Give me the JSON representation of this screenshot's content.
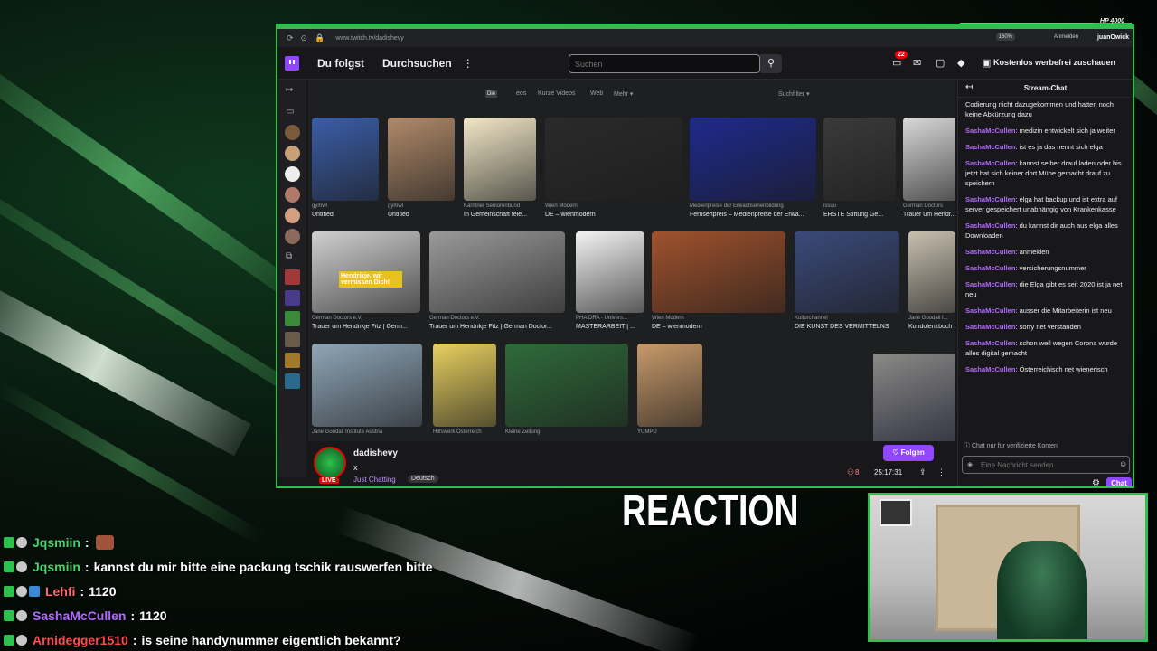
{
  "hud": {
    "hp_label": "HP 4000",
    "hp_fraction": 0.78
  },
  "browser": {
    "url": "www.twitch.tv/dadishevy",
    "zoom": "160%",
    "profile_label": "Anmelden",
    "streamer_name": "juanOwick"
  },
  "twitch_nav": {
    "following": "Du folgst",
    "browse": "Durchsuchen",
    "more": "⋮",
    "search_placeholder": "Suchen",
    "notif_count": "22",
    "ad_free": "Kostenlos werbefrei zuschauen"
  },
  "google_tabs": {
    "tooltip": "Die",
    "items": [
      "eos",
      "Kurze Videos",
      "Web",
      "Mehr ▾"
    ],
    "filter": "Suchfilter ▾"
  },
  "image_results": {
    "row1": [
      {
        "src": "gymwl",
        "title": "Untitled",
        "color": "#3b5ea8"
      },
      {
        "src": "gymwl",
        "title": "Untitled",
        "color": "#b08a6a"
      },
      {
        "src": "Kärntner Seniorenbund",
        "title": "In Gemeinschaft feie...",
        "color": "#f2e8c8"
      },
      {
        "src": "Wien Modern",
        "title": "DE – wienmodern",
        "color": "#2a2a2a"
      },
      {
        "src": "Medienpreise der Erwachsenenbildung",
        "title": "Fernsehpreis – Medienpreise der Erwa...",
        "color": "#1e2a8c"
      },
      {
        "src": "issuu",
        "title": "ERSTE Stiftung Ge...",
        "color": "#3a3a3a"
      },
      {
        "src": "German Doctors",
        "title": "Trauer um Hendr...",
        "color": "#d9d9d9"
      }
    ],
    "row2": [
      {
        "src": "German Doctors e.V.",
        "title": "Trauer um Hendrikje Fitz | Germ...",
        "color": "#d0d0d0",
        "overlay": "Hendrikje, wir vermissen Dich!"
      },
      {
        "src": "German Doctors e.V.",
        "title": "Trauer um Hendrikje Fitz | German Doctor...",
        "color": "#9a9a9a"
      },
      {
        "src": "PHAIDRA - Univers...",
        "title": "MASTERARBEIT | ...",
        "color": "#f4f4f4"
      },
      {
        "src": "Wien Modern",
        "title": "DE – wienmodern",
        "color": "#a0522d"
      },
      {
        "src": "Kulturchannel",
        "title": "DIE KUNST DES VERMITTELNS",
        "color": "#3a4a7a"
      },
      {
        "src": "Jane Goodall I...",
        "title": "Kondolenzbuch ...",
        "color": "#c8c0b0"
      }
    ],
    "row3": [
      {
        "src": "Jane Goodall Institute Austria",
        "title": "",
        "color": "#8fa6b8"
      },
      {
        "src": "Hilfswerk Österreich",
        "title": "",
        "color": "#e8d060"
      },
      {
        "src": "Kleine Zeitung",
        "title": "",
        "color": "#2f6b3a"
      },
      {
        "src": "YUMPU",
        "title": "",
        "color": "#c89a6a"
      }
    ]
  },
  "stream_info": {
    "channel": "dadishevy",
    "title": "x",
    "category": "Just Chatting",
    "tag": "Deutsch",
    "live": "LIVE",
    "follow": "♡ Folgen",
    "viewers": "8",
    "uptime": "25:17:31"
  },
  "chat": {
    "header": "Stream-Chat",
    "messages": [
      {
        "user": "",
        "text": "Codierung nicht dazugekommen und hatten noch keine Abkürzung dazu"
      },
      {
        "user": "SashaMcCullen",
        "text": "medizin entwickelt sich ja weiter"
      },
      {
        "user": "SashaMcCullen",
        "text": "ist es ja das nennt sich elga"
      },
      {
        "user": "SashaMcCullen",
        "text": "kannst selber drauf laden oder bis jetzt hat sich keiner dort Mühe gemacht drauf zu speichern"
      },
      {
        "user": "SashaMcCullen",
        "text": "elga hat backup und ist extra auf server gespeichert unabhängig von Krankenkasse"
      },
      {
        "user": "SashaMcCullen",
        "text": "du kannst dir auch aus elga alles Downloaden"
      },
      {
        "user": "SashaMcCullen",
        "text": "anmelden"
      },
      {
        "user": "SashaMcCullen",
        "text": "versicherungsnummer"
      },
      {
        "user": "SashaMcCullen",
        "text": "die Elga gibt es seit 2020 ist ja net neu"
      },
      {
        "user": "SashaMcCullen",
        "text": "ausser die Mitarbeiterin ist neu"
      },
      {
        "user": "SashaMcCullen",
        "text": "sorry net verstanden"
      },
      {
        "user": "SashaMcCullen",
        "text": "schon weil wegen Corona wurde alles digital gemacht"
      },
      {
        "user": "SashaMcCullen",
        "text": "Österreichisch net wienerisch"
      }
    ],
    "verified_notice": "Chat nur für verifizierte Konten",
    "input_placeholder": "Eine Nachricht senden",
    "send_label": "Chat"
  },
  "overlay": {
    "title": "REACTION",
    "messages": [
      {
        "user": "Jqsmiin",
        "color": "#3fd86a",
        "text": "",
        "emote": true
      },
      {
        "user": "Jqsmiin",
        "color": "#3fd86a",
        "text": "kannst du mir bitte eine packung tschik rauswerfen bitte",
        "emote": false
      },
      {
        "user": "Lehfi",
        "color": "#ff6a6a",
        "text": "1120",
        "emote": false
      },
      {
        "user": "SashaMcCullen",
        "color": "#b16bff",
        "text": "1120",
        "emote": false
      },
      {
        "user": "Arnidegger1510",
        "color": "#ff4a4a",
        "text": "is seine handynummer eigentlich bekannt?",
        "emote": false
      }
    ]
  }
}
